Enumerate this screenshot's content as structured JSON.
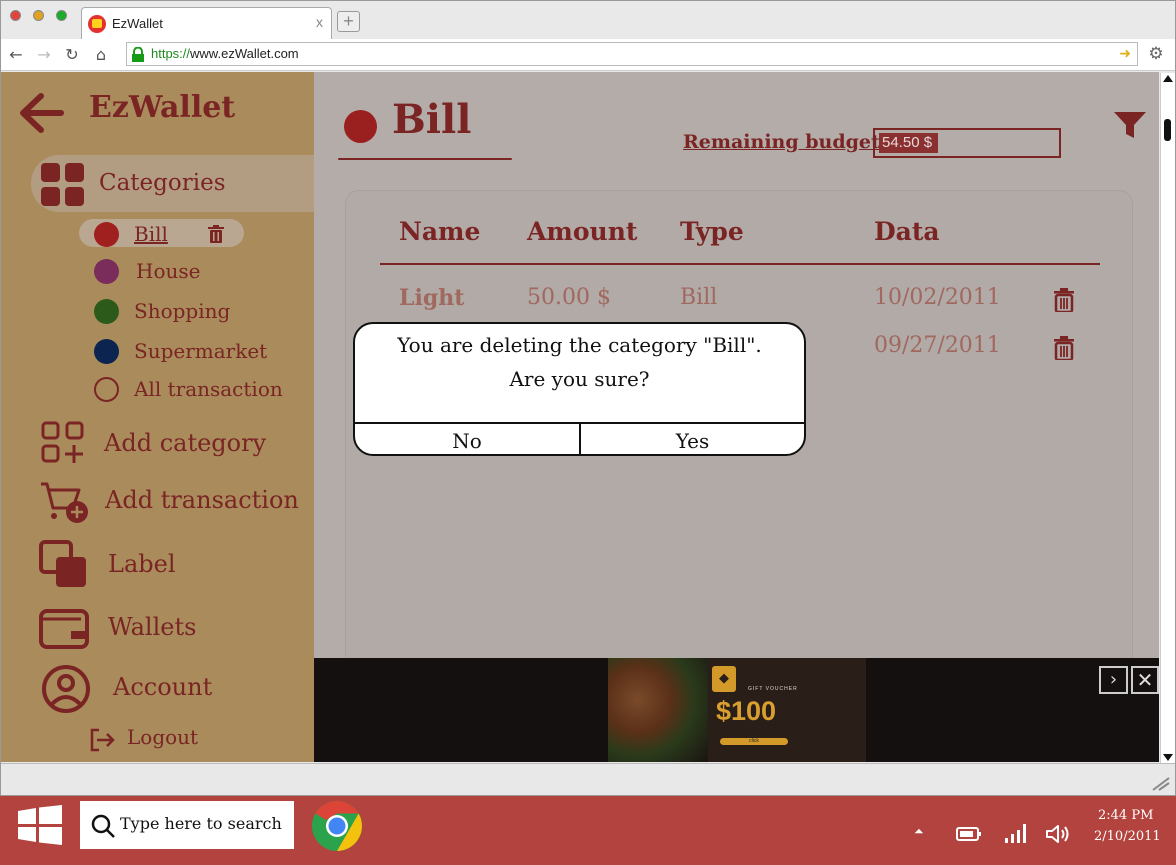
{
  "browser": {
    "tab_title": "EzWallet",
    "tab_close": "x",
    "new_tab": "+",
    "url_scheme": "https://",
    "url_rest": "www.ezWallet.com"
  },
  "sidebar": {
    "app_title": "EzWallet",
    "categories_label": "Categories",
    "categories": [
      {
        "label": "Bill",
        "color": "#a01f1f"
      },
      {
        "label": "House",
        "color": "#7a2c5a"
      },
      {
        "label": "Shopping",
        "color": "#2c5a1a"
      },
      {
        "label": "Supermarket",
        "color": "#0c2450"
      },
      {
        "label": "All transaction",
        "color": "none"
      }
    ],
    "menu": {
      "add_category": "Add category",
      "add_transaction": "Add transaction",
      "label": "Label",
      "wallets": "Wallets",
      "account": "Account",
      "logout": "Logout"
    }
  },
  "main": {
    "category_title": "Bill",
    "remaining_budget_label": "Remaining budget",
    "remaining_budget_value": "54.50 $",
    "table": {
      "headers": [
        "Name",
        "Amount",
        "Type",
        "Data"
      ],
      "rows": [
        {
          "name": "Light",
          "amount": "50.00 $",
          "type": "Bill",
          "date": "10/02/2011"
        },
        {
          "name": "",
          "amount": "",
          "type": "",
          "date": "09/27/2011"
        }
      ]
    }
  },
  "dialog": {
    "line1": "You are deleting the category \"Bill\".",
    "line2": "Are you sure?",
    "no_label": "No",
    "yes_label": "Yes"
  },
  "ad": {
    "small_text": "GIFT VOUCHER",
    "price": "$100",
    "cta": "click"
  },
  "taskbar": {
    "search_placeholder": "Type here to search",
    "time": "2:44 PM",
    "date": "2/10/2011"
  },
  "colors": {
    "accent": "#7a2424",
    "sidebar_bg": "#a98b5c",
    "taskbar_bg": "#b3433e"
  }
}
